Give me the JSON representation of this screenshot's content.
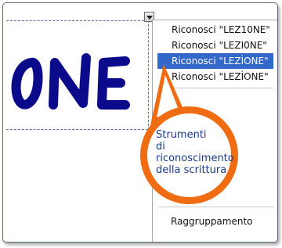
{
  "menu": {
    "items": [
      {
        "label": "Riconosci \"LEZ10NE\"",
        "selected": false
      },
      {
        "label": "Riconosci \"LEZI0NE\"",
        "selected": false
      },
      {
        "label": "Riconosci \"LEZÌONE\"",
        "selected": true
      },
      {
        "label": "Riconosci \"LEZÌONE\"",
        "selected": false
      }
    ],
    "bottom_item": "Raggruppamento"
  },
  "callout": {
    "lines": [
      "Strumenti",
      "di riconoscimento",
      "della scrittura"
    ],
    "ring_color": "#ef6c12",
    "text_color": "#1a3a8c"
  },
  "handwriting": {
    "text": "0NE",
    "ink_color": "#0a0a8a"
  },
  "colors": {
    "selection": "#3468c8"
  },
  "icons": {
    "dropdown": "chevron-down-icon"
  }
}
